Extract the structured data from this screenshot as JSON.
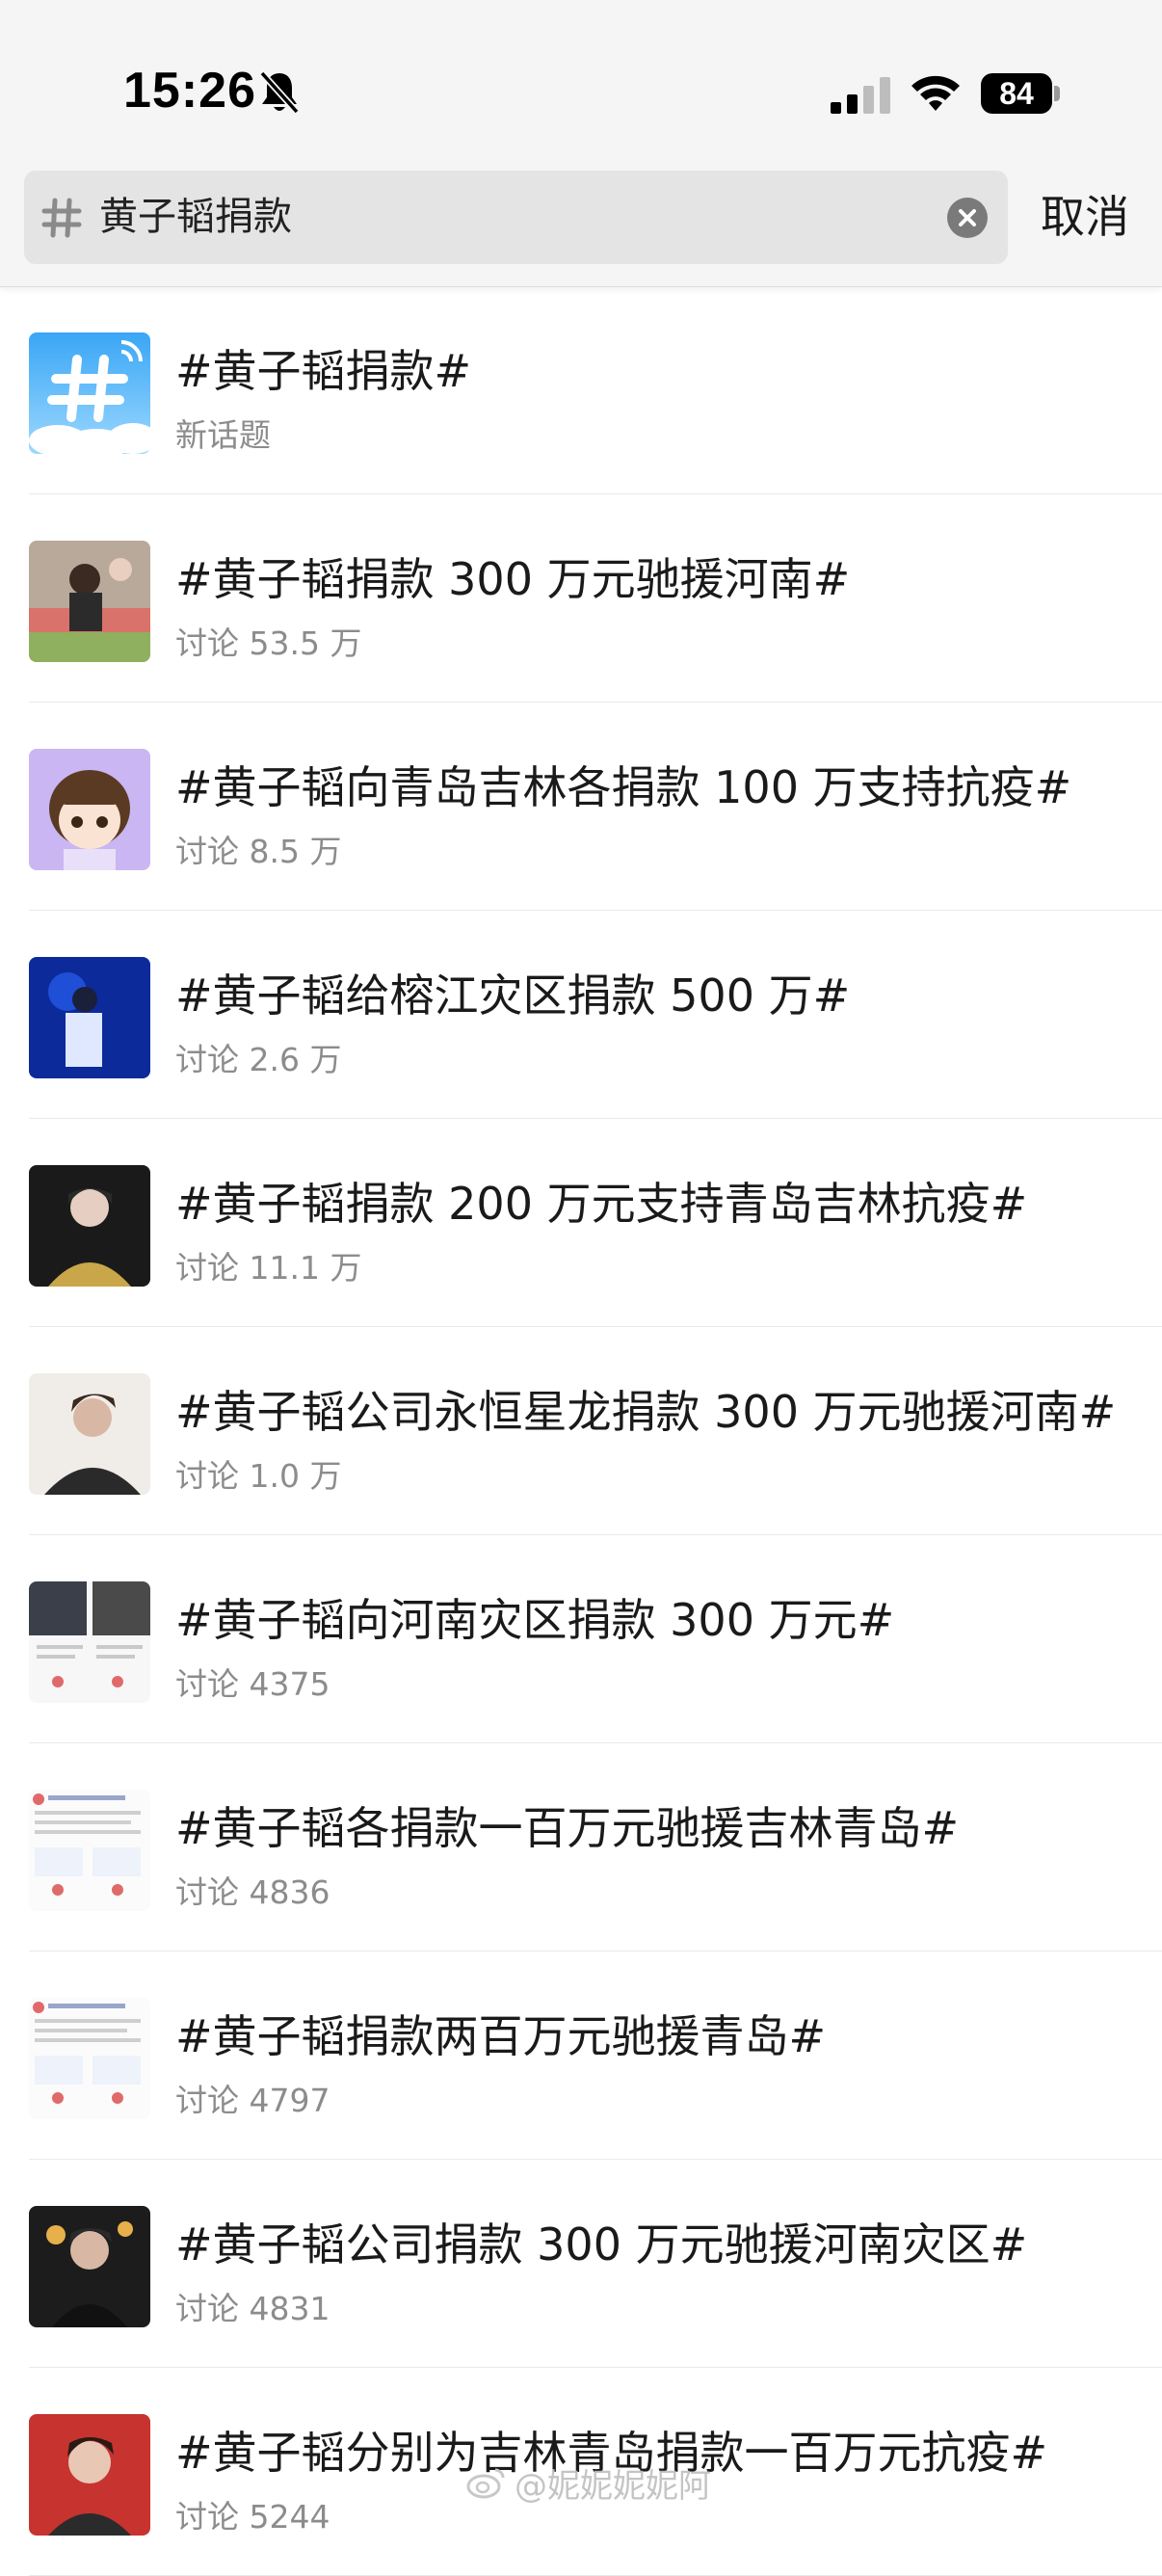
{
  "status_bar": {
    "time": "15:26",
    "battery": "84",
    "icons": [
      "bell-muted-icon",
      "cellular-signal-icon",
      "wifi-icon",
      "battery-icon"
    ]
  },
  "search": {
    "query": "黄子韬捐款",
    "icon": "hashtag-icon",
    "clear_icon": "clear-icon",
    "cancel_label": "取消"
  },
  "results": [
    {
      "title": "#黄子韬捐款#",
      "subtitle": "新话题"
    },
    {
      "title": "#黄子韬捐款 300 万元驰援河南#",
      "subtitle": "讨论 53.5 万"
    },
    {
      "title": "#黄子韬向青岛吉林各捐款 100 万支持抗疫#",
      "subtitle": "讨论 8.5 万"
    },
    {
      "title": "#黄子韬给榕江灾区捐款 500 万#",
      "subtitle": "讨论 2.6 万"
    },
    {
      "title": "#黄子韬捐款 200 万元支持青岛吉林抗疫#",
      "subtitle": "讨论 11.1 万"
    },
    {
      "title": "#黄子韬公司永恒星龙捐款 300 万元驰援河南#",
      "subtitle": "讨论 1.0 万"
    },
    {
      "title": "#黄子韬向河南灾区捐款 300 万元#",
      "subtitle": "讨论 4375"
    },
    {
      "title": "#黄子韬各捐款一百万元驰援吉林青岛#",
      "subtitle": "讨论 4836"
    },
    {
      "title": "#黄子韬捐款两百万元驰援青岛#",
      "subtitle": "讨论 4797"
    },
    {
      "title": "#黄子韬公司捐款 300 万元驰援河南灾区#",
      "subtitle": "讨论 4831"
    },
    {
      "title": "#黄子韬分别为吉林青岛捐款一百万元抗疫#",
      "subtitle": "讨论 5244"
    }
  ],
  "watermark": "@妮妮妮妮阿",
  "colors": {
    "header_bg": "#f5f5f5",
    "search_bg": "#e4e4e4",
    "subtitle": "#8c8c8c",
    "divider": "#e9e9e9"
  }
}
